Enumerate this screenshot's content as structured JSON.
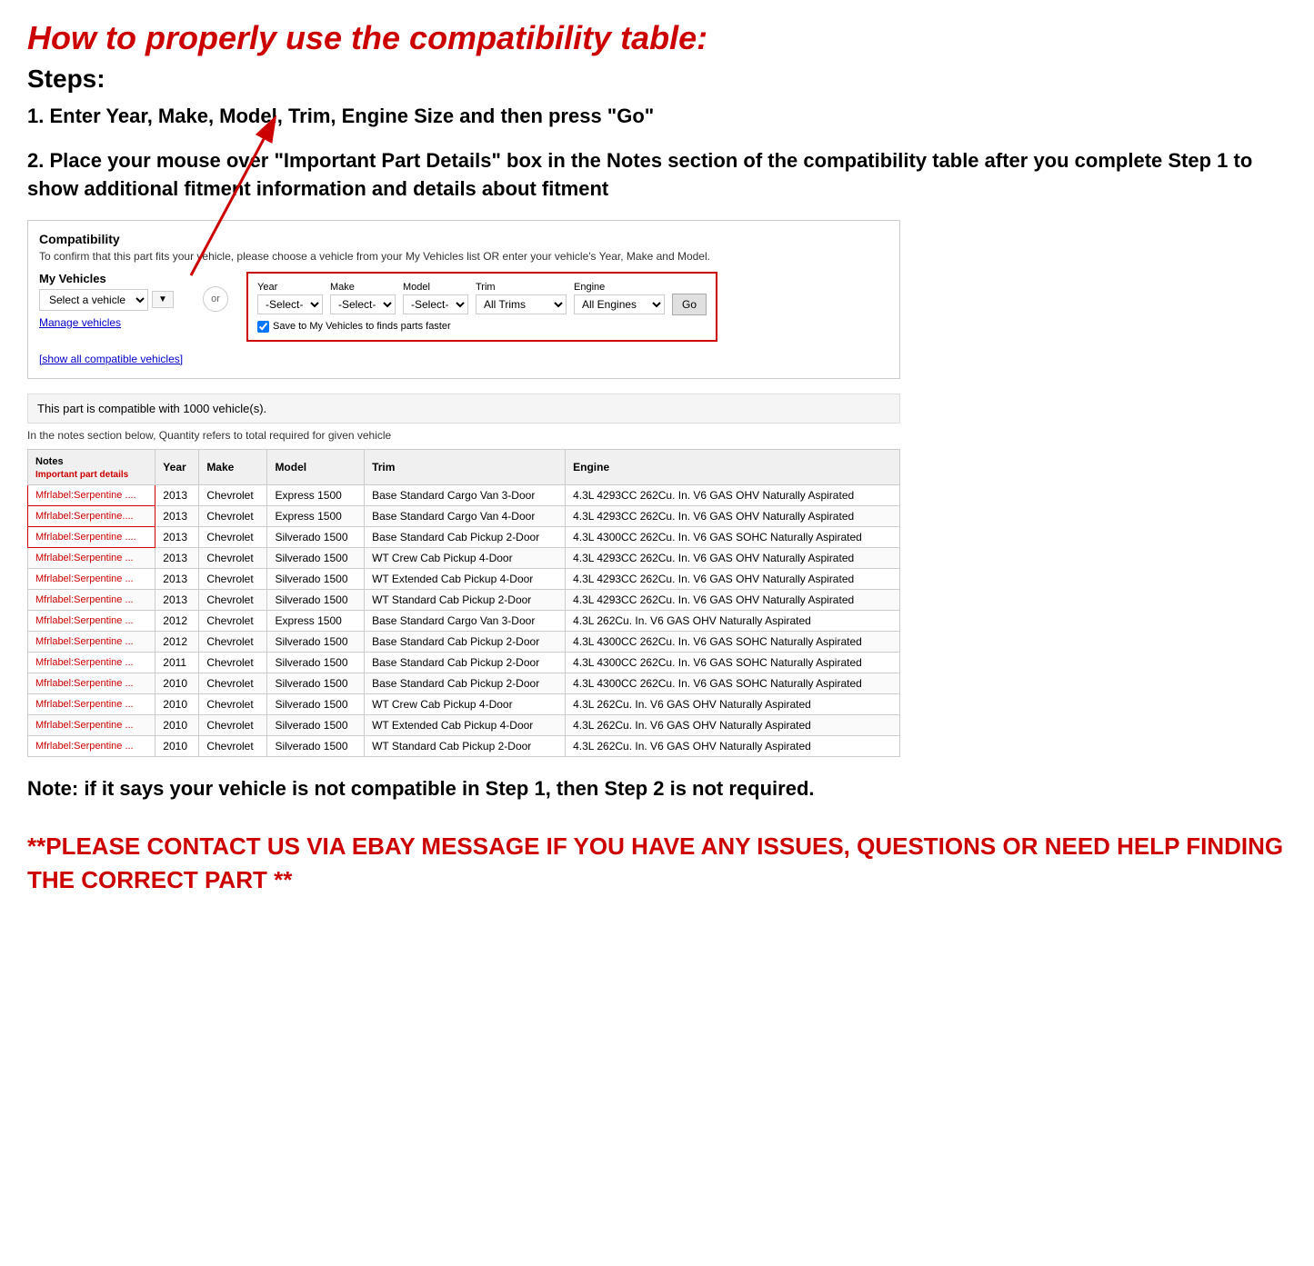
{
  "page": {
    "main_title": "How to properly use the compatibility table:",
    "steps_heading": "Steps:",
    "step1": "1. Enter Year, Make, Model, Trim, Engine Size and then press \"Go\"",
    "step2": "2. Place your mouse over \"Important Part Details\" box in the Notes section of the compatibility table after you complete Step 1 to show additional fitment information and details about fitment",
    "note": "Note: if it says your vehicle is not compatible in Step 1, then Step 2 is not required.",
    "contact": "**PLEASE CONTACT US VIA EBAY MESSAGE IF YOU HAVE ANY ISSUES, QUESTIONS OR NEED HELP FINDING THE CORRECT PART **"
  },
  "compatibility_section": {
    "title": "Compatibility",
    "subtitle": "To confirm that this part fits your vehicle, please choose a vehicle from your My Vehicles list OR enter your vehicle's Year, Make and Model.",
    "my_vehicles_label": "My Vehicles",
    "select_vehicle_placeholder": "Select a vehicle",
    "or_label": "or",
    "manage_vehicles": "Manage vehicles",
    "show_all": "[show all compatible vehicles]",
    "year_label": "Year",
    "make_label": "Make",
    "model_label": "Model",
    "trim_label": "Trim",
    "engine_label": "Engine",
    "year_value": "-Select-",
    "make_value": "-Select-",
    "model_value": "-Select-",
    "trim_value": "All Trims",
    "engine_value": "All Engines",
    "go_label": "Go",
    "save_label": "Save to My Vehicles to finds parts faster",
    "compatible_count": "This part is compatible with 1000 vehicle(s).",
    "quantity_note": "In the notes section below, Quantity refers to total required for given vehicle"
  },
  "table": {
    "headers": [
      "Notes",
      "Year",
      "Make",
      "Model",
      "Trim",
      "Engine"
    ],
    "notes_sub": "Important part details",
    "rows": [
      {
        "notes": "Mfrlabel:Serpentine ....",
        "year": "2013",
        "make": "Chevrolet",
        "model": "Express 1500",
        "trim": "Base Standard Cargo Van 3-Door",
        "engine": "4.3L 4293CC 262Cu. In. V6 GAS OHV Naturally Aspirated"
      },
      {
        "notes": "Mfrlabel:Serpentine....",
        "year": "2013",
        "make": "Chevrolet",
        "model": "Express 1500",
        "trim": "Base Standard Cargo Van 4-Door",
        "engine": "4.3L 4293CC 262Cu. In. V6 GAS OHV Naturally Aspirated"
      },
      {
        "notes": "Mfrlabel:Serpentine ....",
        "year": "2013",
        "make": "Chevrolet",
        "model": "Silverado 1500",
        "trim": "Base Standard Cab Pickup 2-Door",
        "engine": "4.3L 4300CC 262Cu. In. V6 GAS SOHC Naturally Aspirated"
      },
      {
        "notes": "Mfrlabel:Serpentine ...",
        "year": "2013",
        "make": "Chevrolet",
        "model": "Silverado 1500",
        "trim": "WT Crew Cab Pickup 4-Door",
        "engine": "4.3L 4293CC 262Cu. In. V6 GAS OHV Naturally Aspirated"
      },
      {
        "notes": "Mfrlabel:Serpentine ...",
        "year": "2013",
        "make": "Chevrolet",
        "model": "Silverado 1500",
        "trim": "WT Extended Cab Pickup 4-Door",
        "engine": "4.3L 4293CC 262Cu. In. V6 GAS OHV Naturally Aspirated"
      },
      {
        "notes": "Mfrlabel:Serpentine ...",
        "year": "2013",
        "make": "Chevrolet",
        "model": "Silverado 1500",
        "trim": "WT Standard Cab Pickup 2-Door",
        "engine": "4.3L 4293CC 262Cu. In. V6 GAS OHV Naturally Aspirated"
      },
      {
        "notes": "Mfrlabel:Serpentine ...",
        "year": "2012",
        "make": "Chevrolet",
        "model": "Express 1500",
        "trim": "Base Standard Cargo Van 3-Door",
        "engine": "4.3L 262Cu. In. V6 GAS OHV Naturally Aspirated"
      },
      {
        "notes": "Mfrlabel:Serpentine ...",
        "year": "2012",
        "make": "Chevrolet",
        "model": "Silverado 1500",
        "trim": "Base Standard Cab Pickup 2-Door",
        "engine": "4.3L 4300CC 262Cu. In. V6 GAS SOHC Naturally Aspirated"
      },
      {
        "notes": "Mfrlabel:Serpentine ...",
        "year": "2011",
        "make": "Chevrolet",
        "model": "Silverado 1500",
        "trim": "Base Standard Cab Pickup 2-Door",
        "engine": "4.3L 4300CC 262Cu. In. V6 GAS SOHC Naturally Aspirated"
      },
      {
        "notes": "Mfrlabel:Serpentine ...",
        "year": "2010",
        "make": "Chevrolet",
        "model": "Silverado 1500",
        "trim": "Base Standard Cab Pickup 2-Door",
        "engine": "4.3L 4300CC 262Cu. In. V6 GAS SOHC Naturally Aspirated"
      },
      {
        "notes": "Mfrlabel:Serpentine ...",
        "year": "2010",
        "make": "Chevrolet",
        "model": "Silverado 1500",
        "trim": "WT Crew Cab Pickup 4-Door",
        "engine": "4.3L 262Cu. In. V6 GAS OHV Naturally Aspirated"
      },
      {
        "notes": "Mfrlabel:Serpentine ...",
        "year": "2010",
        "make": "Chevrolet",
        "model": "Silverado 1500",
        "trim": "WT Extended Cab Pickup 4-Door",
        "engine": "4.3L 262Cu. In. V6 GAS OHV Naturally Aspirated"
      },
      {
        "notes": "Mfrlabel:Serpentine ...",
        "year": "2010",
        "make": "Chevrolet",
        "model": "Silverado 1500",
        "trim": "WT Standard Cab Pickup 2-Door",
        "engine": "4.3L 262Cu. In. V6 GAS OHV Naturally Aspirated"
      }
    ]
  }
}
